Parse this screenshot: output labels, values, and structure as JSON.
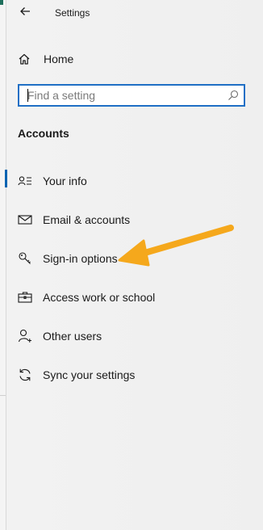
{
  "window": {
    "title": "Settings",
    "back_icon": "back-arrow-icon"
  },
  "home": {
    "label": "Home",
    "icon": "home-icon"
  },
  "search": {
    "placeholder": "Find a setting",
    "value": "",
    "icon": "search-icon"
  },
  "section": {
    "heading": "Accounts"
  },
  "nav": {
    "selected_index": 0,
    "items": [
      {
        "label": "Your info",
        "icon": "person-card-icon"
      },
      {
        "label": "Email & accounts",
        "icon": "mail-icon"
      },
      {
        "label": "Sign-in options",
        "icon": "key-icon"
      },
      {
        "label": "Access work or school",
        "icon": "briefcase-icon"
      },
      {
        "label": "Other users",
        "icon": "person-add-icon"
      },
      {
        "label": "Sync your settings",
        "icon": "sync-icon"
      }
    ]
  },
  "annotation": {
    "type": "arrow",
    "color": "#f5a81c",
    "points_to": "Sign-in options"
  },
  "colors": {
    "accent": "#0063b1",
    "search_border": "#1f6fc5",
    "panel_background": "#f2f2f2"
  }
}
